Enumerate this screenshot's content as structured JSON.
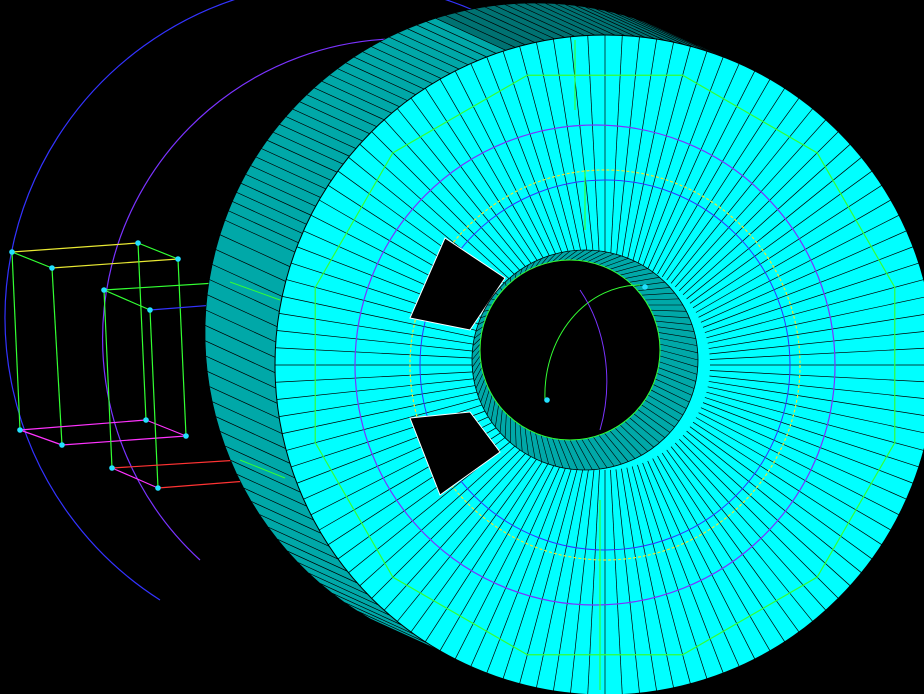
{
  "viewport": {
    "background": "#000000"
  },
  "colors": {
    "face": "#00ffff",
    "side_face": "#00a8a8",
    "side_face_dark": "#007272",
    "mesh_line": "#000000",
    "highlight_line": "#ffffff",
    "edge_green": "#33ff33",
    "edge_magenta": "#ff33ff",
    "edge_blue": "#3333ff",
    "edge_purple": "#7a33ff",
    "edge_red": "#ff3333",
    "edge_yellow": "#e8e833",
    "vertex_marker": "#22e0ff"
  },
  "mesh": {
    "outer_segments": 120,
    "inner_segments": 96
  }
}
